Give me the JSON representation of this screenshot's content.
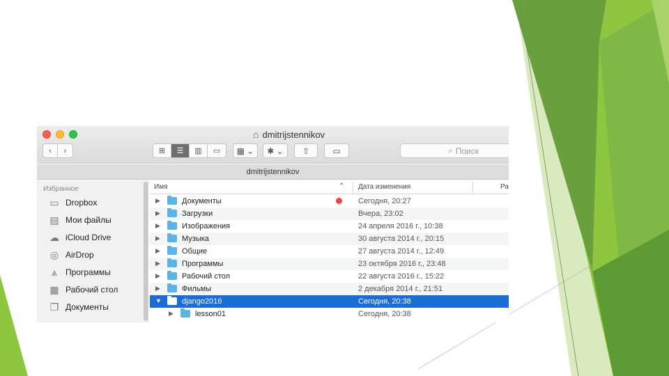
{
  "window": {
    "title": "dmitrijstennikov",
    "path_bar": "dmitrijstennikov"
  },
  "toolbar": {
    "back_icon": "chevron-left-icon",
    "forward_icon": "chevron-right-icon",
    "view_modes": [
      "icon-view",
      "list-view",
      "column-view",
      "cover-flow-view"
    ],
    "active_view": "list-view",
    "search_placeholder": "Поиск"
  },
  "sidebar": {
    "heading": "Избранное",
    "items": [
      {
        "label": "Dropbox",
        "icon": "folder-icon"
      },
      {
        "label": "Мои файлы",
        "icon": "all-files-icon"
      },
      {
        "label": "iCloud Drive",
        "icon": "cloud-icon"
      },
      {
        "label": "AirDrop",
        "icon": "airdrop-icon"
      },
      {
        "label": "Программы",
        "icon": "applications-icon"
      },
      {
        "label": "Рабочий стол",
        "icon": "desktop-icon"
      },
      {
        "label": "Документы",
        "icon": "documents-icon"
      }
    ]
  },
  "list": {
    "columns": {
      "name": "Имя",
      "date": "Дата изменения",
      "size": "Ра"
    },
    "rows": [
      {
        "name": "Документы",
        "date": "Сегодня, 20:27",
        "tag": "red"
      },
      {
        "name": "Загрузки",
        "date": "Вчера, 23:02"
      },
      {
        "name": "Изображения",
        "date": "24 апреля 2016 г., 10:38"
      },
      {
        "name": "Музыка",
        "date": "30 августа 2014 г., 20:15"
      },
      {
        "name": "Общие",
        "date": "27 августа 2014 г., 12:49"
      },
      {
        "name": "Программы",
        "date": "23 октября 2016 г., 23:48"
      },
      {
        "name": "Рабочий стол",
        "date": "22 августа 2016 г., 15:22"
      },
      {
        "name": "Фильмы",
        "date": "2 декабря 2014 г., 21:51"
      },
      {
        "name": "django2016",
        "date": "Сегодня, 20:38",
        "selected": true,
        "expanded": true
      },
      {
        "name": "lesson01",
        "date": "Сегодня, 20:38",
        "child": true
      }
    ]
  },
  "colors": {
    "accent_green": "#8dc63f",
    "dark_green": "#4e8a2f",
    "selection_blue": "#1a6dd8",
    "folder_blue": "#5ab4e8"
  }
}
